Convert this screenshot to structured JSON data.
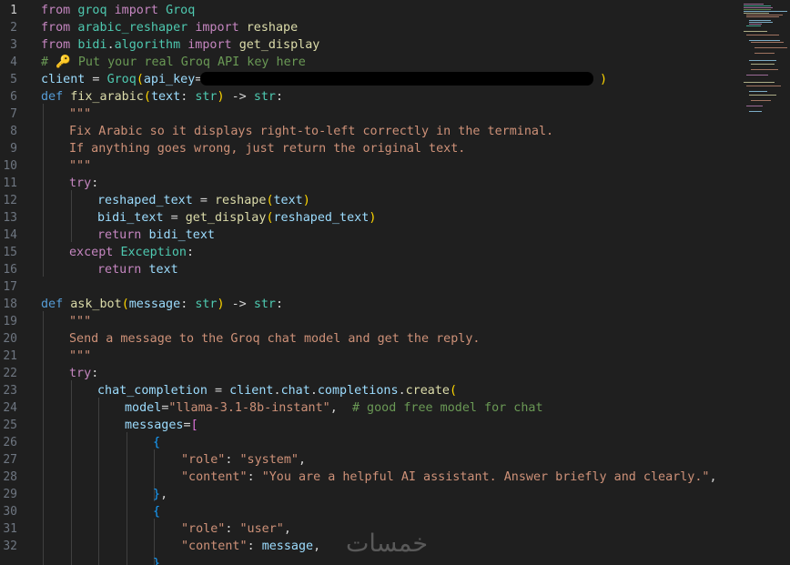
{
  "editor": {
    "language": "python",
    "active_line": 1,
    "line_numbers": [
      "1",
      "2",
      "3",
      "4",
      "5",
      "6",
      "7",
      "8",
      "9",
      "10",
      "11",
      "12",
      "13",
      "14",
      "15",
      "16",
      "17",
      "18",
      "19",
      "20",
      "21",
      "22",
      "23",
      "24",
      "25",
      "26",
      "27",
      "28",
      "29",
      "30",
      "31",
      "32"
    ],
    "code": {
      "l1": {
        "kw1": "from",
        "mod": "groq",
        "kw2": "import",
        "cls": "Groq"
      },
      "l2": {
        "kw1": "from",
        "mod": "arabic_reshaper",
        "kw2": "import",
        "name": "reshape"
      },
      "l3": {
        "kw1": "from",
        "mod1": "bidi",
        "dot": ".",
        "mod2": "algorithm",
        "kw2": "import",
        "name": "get_display"
      },
      "l4": {
        "hash": "#",
        "emoji": "🔑",
        "text": "Put your real Groq API key here"
      },
      "l5": {
        "var": "client",
        "op": " = ",
        "cls": "Groq",
        "open": "(",
        "param": "api_key",
        "eq": "=",
        "close": ")"
      },
      "l6": {
        "def": "def",
        "fn": "fix_arabic",
        "open": "(",
        "param": "text",
        "colon": ": ",
        "type": "str",
        "close": ")",
        "arrow": " -> ",
        "ret": "str",
        "end": ":"
      },
      "l7": {
        "doc": "\"\"\""
      },
      "l8": {
        "doc": "Fix Arabic so it displays right-to-left correctly in the terminal."
      },
      "l9": {
        "doc": "If anything goes wrong, just return the original text."
      },
      "l10": {
        "doc": "\"\"\""
      },
      "l11": {
        "kw": "try",
        "end": ":"
      },
      "l12": {
        "var": "reshaped_text",
        "op": " = ",
        "fn": "reshape",
        "open": "(",
        "arg": "text",
        "close": ")"
      },
      "l13": {
        "var": "bidi_text",
        "op": " = ",
        "fn": "get_display",
        "open": "(",
        "arg": "reshaped_text",
        "close": ")"
      },
      "l14": {
        "kw": "return",
        "var": "bidi_text"
      },
      "l15": {
        "kw": "except",
        "cls": "Exception",
        "end": ":"
      },
      "l16": {
        "kw": "return",
        "var": "text"
      },
      "l18": {
        "def": "def",
        "fn": "ask_bot",
        "open": "(",
        "param": "message",
        "colon": ": ",
        "type": "str",
        "close": ")",
        "arrow": " -> ",
        "ret": "str",
        "end": ":"
      },
      "l19": {
        "doc": "\"\"\""
      },
      "l20": {
        "doc": "Send a message to the Groq chat model and get the reply."
      },
      "l21": {
        "doc": "\"\"\""
      },
      "l22": {
        "kw": "try",
        "end": ":"
      },
      "l23": {
        "var": "chat_completion",
        "op": " = ",
        "obj": "client",
        "dot1": ".",
        "a1": "chat",
        "dot2": ".",
        "a2": "completions",
        "dot3": ".",
        "fn": "create",
        "open": "("
      },
      "l24": {
        "param": "model",
        "eq": "=",
        "str": "\"llama-3.1-8b-instant\"",
        "comma": ",  ",
        "comment": "# good free model for chat"
      },
      "l25": {
        "param": "messages",
        "eq": "=",
        "open": "["
      },
      "l26": {
        "open": "{"
      },
      "l27": {
        "key": "\"role\"",
        "colon": ": ",
        "val": "\"system\"",
        "comma": ","
      },
      "l28": {
        "key": "\"content\"",
        "colon": ": ",
        "val": "\"You are a helpful AI assistant. Answer briefly and clearly.\"",
        "comma": ","
      },
      "l29": {
        "close": "}",
        "comma": ","
      },
      "l30": {
        "open": "{"
      },
      "l31": {
        "key": "\"role\"",
        "colon": ": ",
        "val": "\"user\"",
        "comma": ","
      },
      "l32": {
        "key": "\"content\"",
        "colon": ": ",
        "var": "message",
        "comma": ","
      }
    }
  },
  "watermark": {
    "text": "خمسات"
  },
  "colors": {
    "background": "#1f1f1f",
    "keyword": "#c586c0",
    "def_keyword": "#569cd6",
    "type": "#4ec9b0",
    "function": "#dcdcaa",
    "variable": "#9cdcfe",
    "string": "#ce9178",
    "comment": "#6a9955"
  }
}
